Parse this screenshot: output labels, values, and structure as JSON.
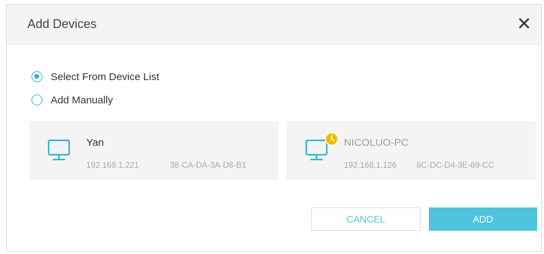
{
  "dialog": {
    "title": "Add Devices",
    "close_icon": "close-icon"
  },
  "options": {
    "select_from_list": {
      "label": "Select From Device List",
      "checked": true
    },
    "add_manually": {
      "label": "Add Manually",
      "checked": false
    }
  },
  "devices": [
    {
      "name": "Yan",
      "ip": "192.168.1.221",
      "mac": "38-CA-DA-3A-D8-B1",
      "icon": "monitor-icon",
      "online": true
    },
    {
      "name": "NICOLUO-PC",
      "ip": "192.168.1.126",
      "mac": "8C-DC-D4-3E-69-CC",
      "icon": "monitor-icon",
      "status_icon": "offline-clock-icon",
      "online": false
    }
  ],
  "buttons": {
    "cancel_label": "CANCEL",
    "add_label": "ADD"
  },
  "colors": {
    "accent": "#4fc4dd",
    "radio": "#2fb6d0",
    "status_warning": "#f5b700",
    "header_bg": "#f4f4f4",
    "card_bg": "#f4f4f4"
  }
}
